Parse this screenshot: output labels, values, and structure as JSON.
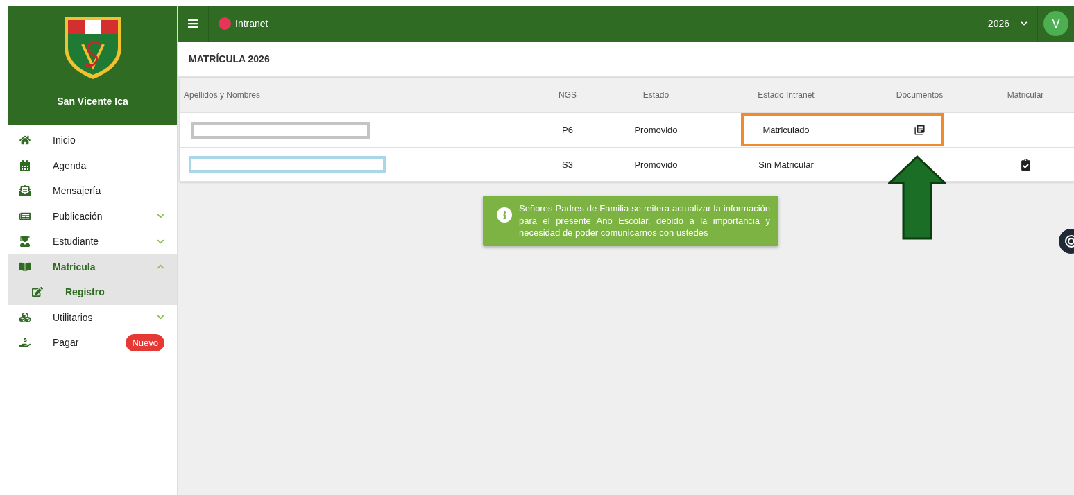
{
  "sidebar": {
    "school_name": "San Vicente Ica",
    "items": [
      {
        "label": "Inicio",
        "kind": "link",
        "selected": false
      },
      {
        "label": "Agenda",
        "kind": "link",
        "selected": false
      },
      {
        "label": "Mensajería",
        "kind": "link",
        "selected": false
      },
      {
        "label": "Publicación",
        "kind": "group",
        "expanded": false,
        "selected": false
      },
      {
        "label": "Estudiante",
        "kind": "group",
        "expanded": false,
        "selected": false
      },
      {
        "label": "Matrícula",
        "kind": "group",
        "expanded": true,
        "selected": true,
        "children": [
          {
            "label": "Registro",
            "selected": true
          }
        ]
      },
      {
        "label": "Utilitarios",
        "kind": "group",
        "expanded": false,
        "selected": false
      },
      {
        "label": "Pagar",
        "kind": "link",
        "selected": false,
        "badge": "Nuevo"
      }
    ]
  },
  "topbar": {
    "app_label": "Intranet",
    "year": "2026",
    "avatar_letter": "V"
  },
  "page_title": "MATRÍCULA 2026",
  "table": {
    "columns": [
      "Apellidos y Nombres",
      "NGS",
      "Estado",
      "Estado Intranet",
      "Documentos",
      "Matricular"
    ],
    "rows": [
      {
        "color": "#c4c4c4",
        "ngs": "P6",
        "estado": "Promovido",
        "estado_intranet": "Matriculado",
        "has_documents": true,
        "can_enroll": false,
        "highlighted": true
      },
      {
        "color": "#a8d8e8",
        "ngs": "S3",
        "estado": "Promovido",
        "estado_intranet": "Sin Matricular",
        "has_documents": false,
        "can_enroll": true,
        "highlighted": false
      }
    ]
  },
  "notice": "Señores Padres de Familia se reitera actualizar la información para el presente Año Escolar, debido a la importancia y necesidad de poder comunicarnos con ustedes"
}
